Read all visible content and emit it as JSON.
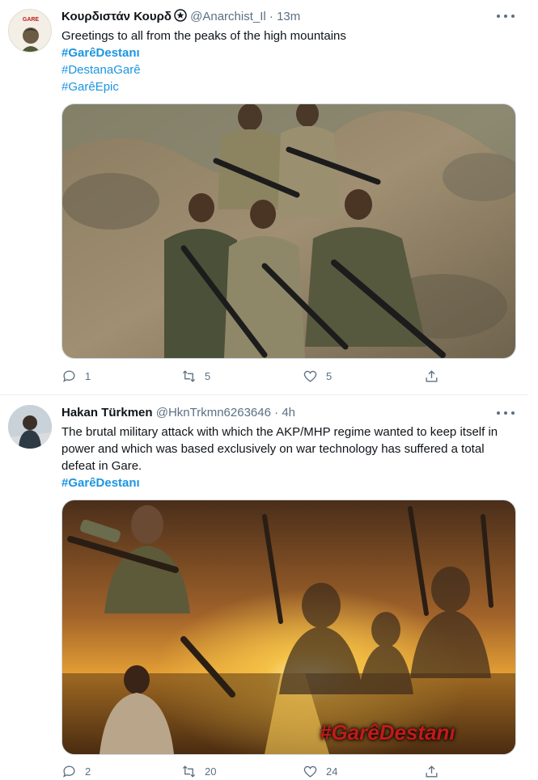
{
  "tweets": [
    {
      "author": "Κουρδιστάν Κουρδ",
      "badge_icon": "star-badge-icon",
      "handle": "@Anarchist_Il",
      "separator": "·",
      "time": "13m",
      "text": "Greetings to all from the peaks of the high mountains",
      "hashtags": [
        "#GarêDestanı",
        "#DestanaGarê",
        "#GarêEpic"
      ],
      "image_alt": "Group of five armed fighters crouching on a rocky, dry hillside",
      "actions": {
        "reply": "1",
        "retweet": "5",
        "like": "5"
      }
    },
    {
      "author": "Hakan Türkmen",
      "handle": "@HknTrkmn6263646",
      "separator": "·",
      "time": "4h",
      "text": "The brutal military attack with which the AKP/MHP regime wanted to keep itself in power and which was based exclusively on war technology has suffered a total defeat in Gare.",
      "hashtags": [
        "#GarêDestanı"
      ],
      "image_alt": "Sunset over water with silhouettes of armed fighters",
      "image_caption": "#GarêDestanı",
      "actions": {
        "reply": "2",
        "retweet": "20",
        "like": "24"
      }
    }
  ],
  "colors": {
    "link": "#1b95e0",
    "muted": "#5b7083",
    "image_caption": "#c21a1a"
  }
}
